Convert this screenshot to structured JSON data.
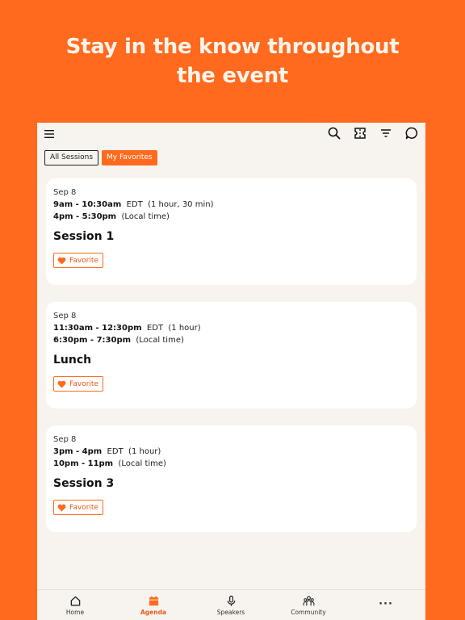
{
  "headline": {
    "line1": "Stay in the know throughout",
    "line2": "the event"
  },
  "topbar": {
    "icons": [
      "menu-icon",
      "search-icon",
      "ticket-icon",
      "filter-icon",
      "chat-icon"
    ]
  },
  "filters": {
    "all_sessions": "All Sessions",
    "my_favorites": "My Favorites",
    "selected": "My Favorites"
  },
  "sessions": [
    {
      "date": "Sep 8",
      "event_time": "9am - 10:30am",
      "event_tz": "EDT",
      "duration": "(1 hour, 30 min)",
      "local_time": "4pm - 5:30pm",
      "local_label": "(Local time)",
      "title": "Session 1",
      "favorite_label": "Favorite"
    },
    {
      "date": "Sep 8",
      "event_time": "11:30am - 12:30pm",
      "event_tz": "EDT",
      "duration": "(1 hour)",
      "local_time": "6:30pm - 7:30pm",
      "local_label": "(Local time)",
      "title": "Lunch",
      "favorite_label": "Favorite"
    },
    {
      "date": "Sep 8",
      "event_time": "3pm - 4pm",
      "event_tz": "EDT",
      "duration": "(1 hour)",
      "local_time": "10pm - 11pm",
      "local_label": "(Local time)",
      "title": "Session 3",
      "favorite_label": "Favorite"
    }
  ],
  "bottom_nav": {
    "home": "Home",
    "agenda": "Agenda",
    "speakers": "Speakers",
    "community": "Community",
    "more": "···",
    "active": "Agenda"
  },
  "colors": {
    "brand": "#FF6A1E",
    "background": "#F7F4F0",
    "card": "#FFFFFF"
  }
}
